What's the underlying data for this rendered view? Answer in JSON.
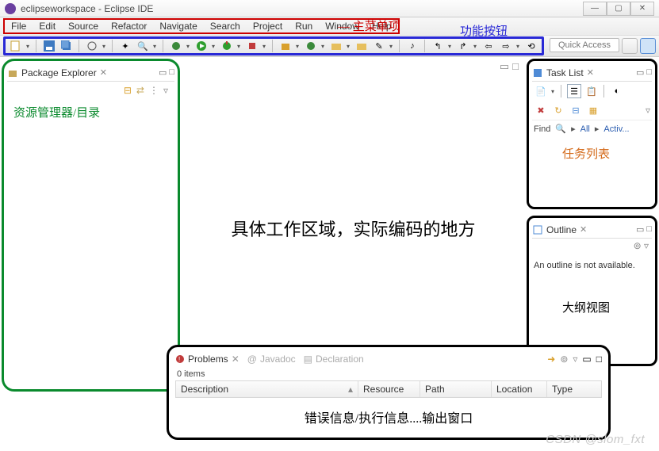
{
  "window": {
    "title": "eclipseworkspace - Eclipse IDE",
    "min": "—",
    "max": "▢",
    "close": "✕"
  },
  "menu": [
    "File",
    "Edit",
    "Source",
    "Refactor",
    "Navigate",
    "Search",
    "Project",
    "Run",
    "Window",
    "Help"
  ],
  "toolbar": {
    "quick_access": "Quick Access"
  },
  "annotations": {
    "main_menu": "主菜单项",
    "toolbar_btns": "功能按钮",
    "pkg_explorer": "资源管理器/目录",
    "editor": "具体工作区域，实际编码的地方",
    "task_list": "任务列表",
    "outline": "大纲视图",
    "problems": "错误信息/执行信息....输出窗口"
  },
  "views": {
    "package_explorer": {
      "title": "Package Explorer"
    },
    "task_list": {
      "title": "Task List",
      "find": "Find",
      "all": "All",
      "activ": "Activ..."
    },
    "outline": {
      "title": "Outline",
      "empty": "An outline is not available."
    },
    "problems": {
      "title": "Problems",
      "javadoc": "Javadoc",
      "declaration": "Declaration",
      "items": "0 items",
      "cols": {
        "description": "Description",
        "resource": "Resource",
        "path": "Path",
        "location": "Location",
        "type": "Type"
      }
    }
  },
  "watermark": "CSDN @slom_fxt",
  "icons": {
    "new": "#d9a02c",
    "save": "#3e7ac1",
    "open": "#d9a02c",
    "debug": "#3b8a3b",
    "run": "#2e9e2e",
    "ext": "#c13b3b",
    "pkg_expl": "#c7a85a",
    "task": "#4f8bd6",
    "outline": "#4f8bd6",
    "problems": "#c13b3b",
    "javadoc": "#c7a85a",
    "decl": "#4f8bd6"
  }
}
